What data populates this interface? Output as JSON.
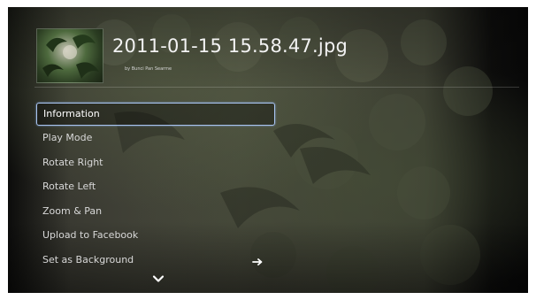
{
  "header": {
    "title": "2011-01-15 15.58.47.jpg",
    "byline": "by Bunci Pan Searme",
    "thumbnail_icon": "photo-thumbnail"
  },
  "menu": {
    "items": [
      {
        "label": "Information",
        "selected": true
      },
      {
        "label": "Play Mode",
        "selected": false
      },
      {
        "label": "Rotate Right",
        "selected": false
      },
      {
        "label": "Rotate Left",
        "selected": false
      },
      {
        "label": "Zoom & Pan",
        "selected": false
      },
      {
        "label": "Upload to Facebook",
        "selected": false
      },
      {
        "label": "Set as Background",
        "selected": false
      }
    ],
    "submenu_icon": "arrow-right-icon",
    "more_icon": "chevron-down-icon"
  },
  "colors": {
    "selection_border": "#a9c4f0",
    "text": "#d8d8d8",
    "title": "#f2f2f2"
  }
}
